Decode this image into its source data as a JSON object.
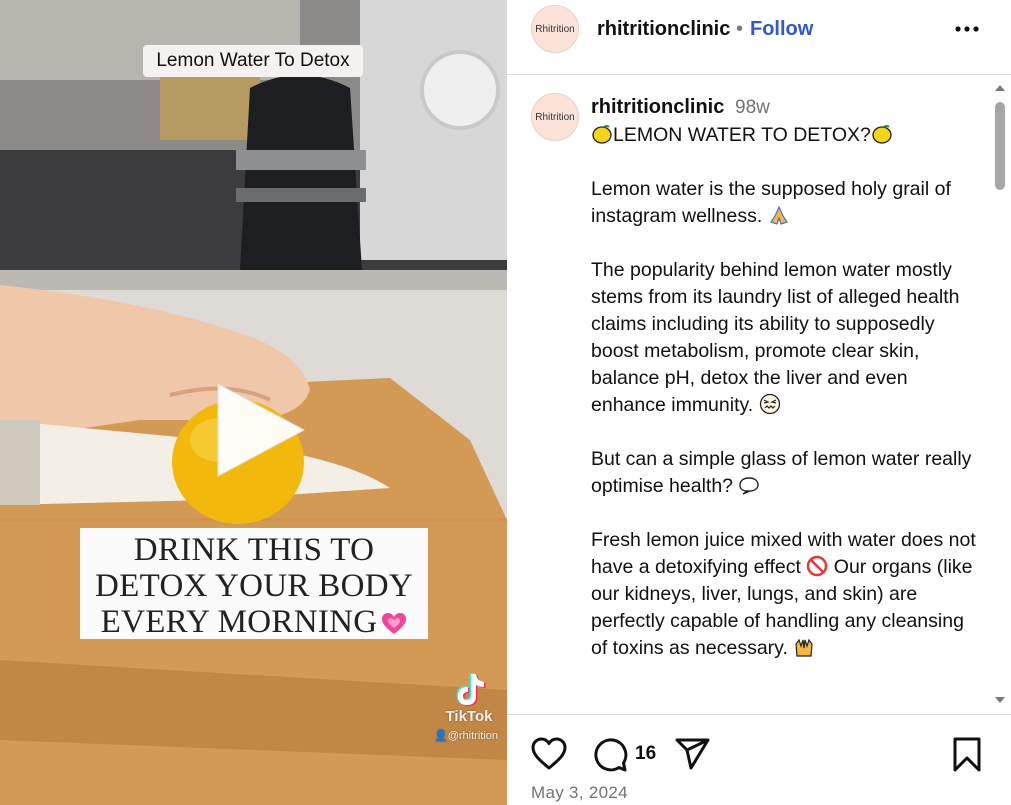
{
  "video": {
    "caption_chip": "Lemon Water To Detox",
    "overlay_lines": [
      "DRINK THIS TO",
      "DETOX YOUR BODY",
      "EVERY MORNING"
    ],
    "tiktok_brand": "TikTok",
    "tiktok_handle": "@rhitrition"
  },
  "header": {
    "avatar_text": "Rhitrition",
    "username": "rhitritionclinic",
    "separator": "•",
    "follow_label": "Follow"
  },
  "caption": {
    "avatar_text": "Rhitrition",
    "username": "rhitritionclinic",
    "age": "98w",
    "title": "LEMON WATER TO DETOX?",
    "p1": "Lemon water is the supposed holy grail of instagram wellness.",
    "p2": "The popularity behind lemon water mostly stems from its laundry list of alleged health claims including its ability to supposedly boost metabolism, promote clear skin, balance pH, detox the liver and even enhance immunity.",
    "p3": "But can a simple glass of lemon water really optimise health?",
    "p4a": "Fresh lemon juice mixed with water does not have a detoxifying effect",
    "p4b": "Our organs (like our kidneys, liver, lungs, and skin) are perfectly capable of handling any cleansing of toxins as necessary."
  },
  "actions": {
    "comment_count": "16",
    "date": "May 3, 2024"
  },
  "icons": {
    "more": "more-options-icon",
    "like": "heart-outline-icon",
    "comment": "comment-bubble-icon",
    "share": "paper-plane-icon",
    "save": "bookmark-icon",
    "play": "play-icon"
  },
  "colors": {
    "follow": "#3257d6",
    "muted": "#737373",
    "divider": "#dbdbdb"
  }
}
